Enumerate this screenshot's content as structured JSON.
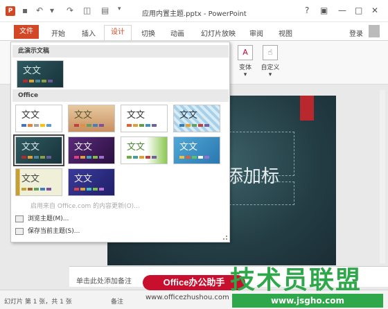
{
  "titlebar": {
    "app_icon": "P",
    "save_icon": "save-icon",
    "undo_glyph": "↶",
    "redo_glyph": "↷",
    "title": "应用内置主题.pptx - PowerPoint",
    "help": "?",
    "ribbon_display": "▣",
    "minimize": "—",
    "maximize": "□",
    "close": "✕"
  },
  "tabs": {
    "file": "文件",
    "home": "开始",
    "insert": "插入",
    "design": "设计",
    "transitions": "切换",
    "animations": "动画",
    "slideshow": "幻灯片放映",
    "review": "审阅",
    "view": "视图",
    "login": "登录"
  },
  "ribbon": {
    "variants_label": "变体",
    "variants_arrow": "▾",
    "customize_label": "自定义",
    "customize_arrow": "▾"
  },
  "gallery": {
    "section_this": "此演示文稿",
    "section_office": "Office",
    "thumb_text": "文文",
    "menu_enable_updates": "启用来自 Office.com 的内容更新(O)...",
    "menu_browse": "浏览主题(M)...",
    "menu_save": "保存当前主题(S)..."
  },
  "slide": {
    "title_placeholder": "添加标"
  },
  "notes": {
    "placeholder": "单击此处添加备注"
  },
  "statusbar": {
    "slide_info": "幻灯片 第 1 张，共 1 张",
    "notes_btn": "备注"
  },
  "watermark": {
    "badge": "Office办公助手",
    "big": "技术员联盟",
    "url": "www.jsgho.com",
    "url2": "www.officezhushou.com"
  },
  "colors": {
    "accent": "#d24726",
    "slide_red": "#b9282c",
    "watermark_green": "#2ea84a",
    "badge_red": "#c8102e"
  }
}
